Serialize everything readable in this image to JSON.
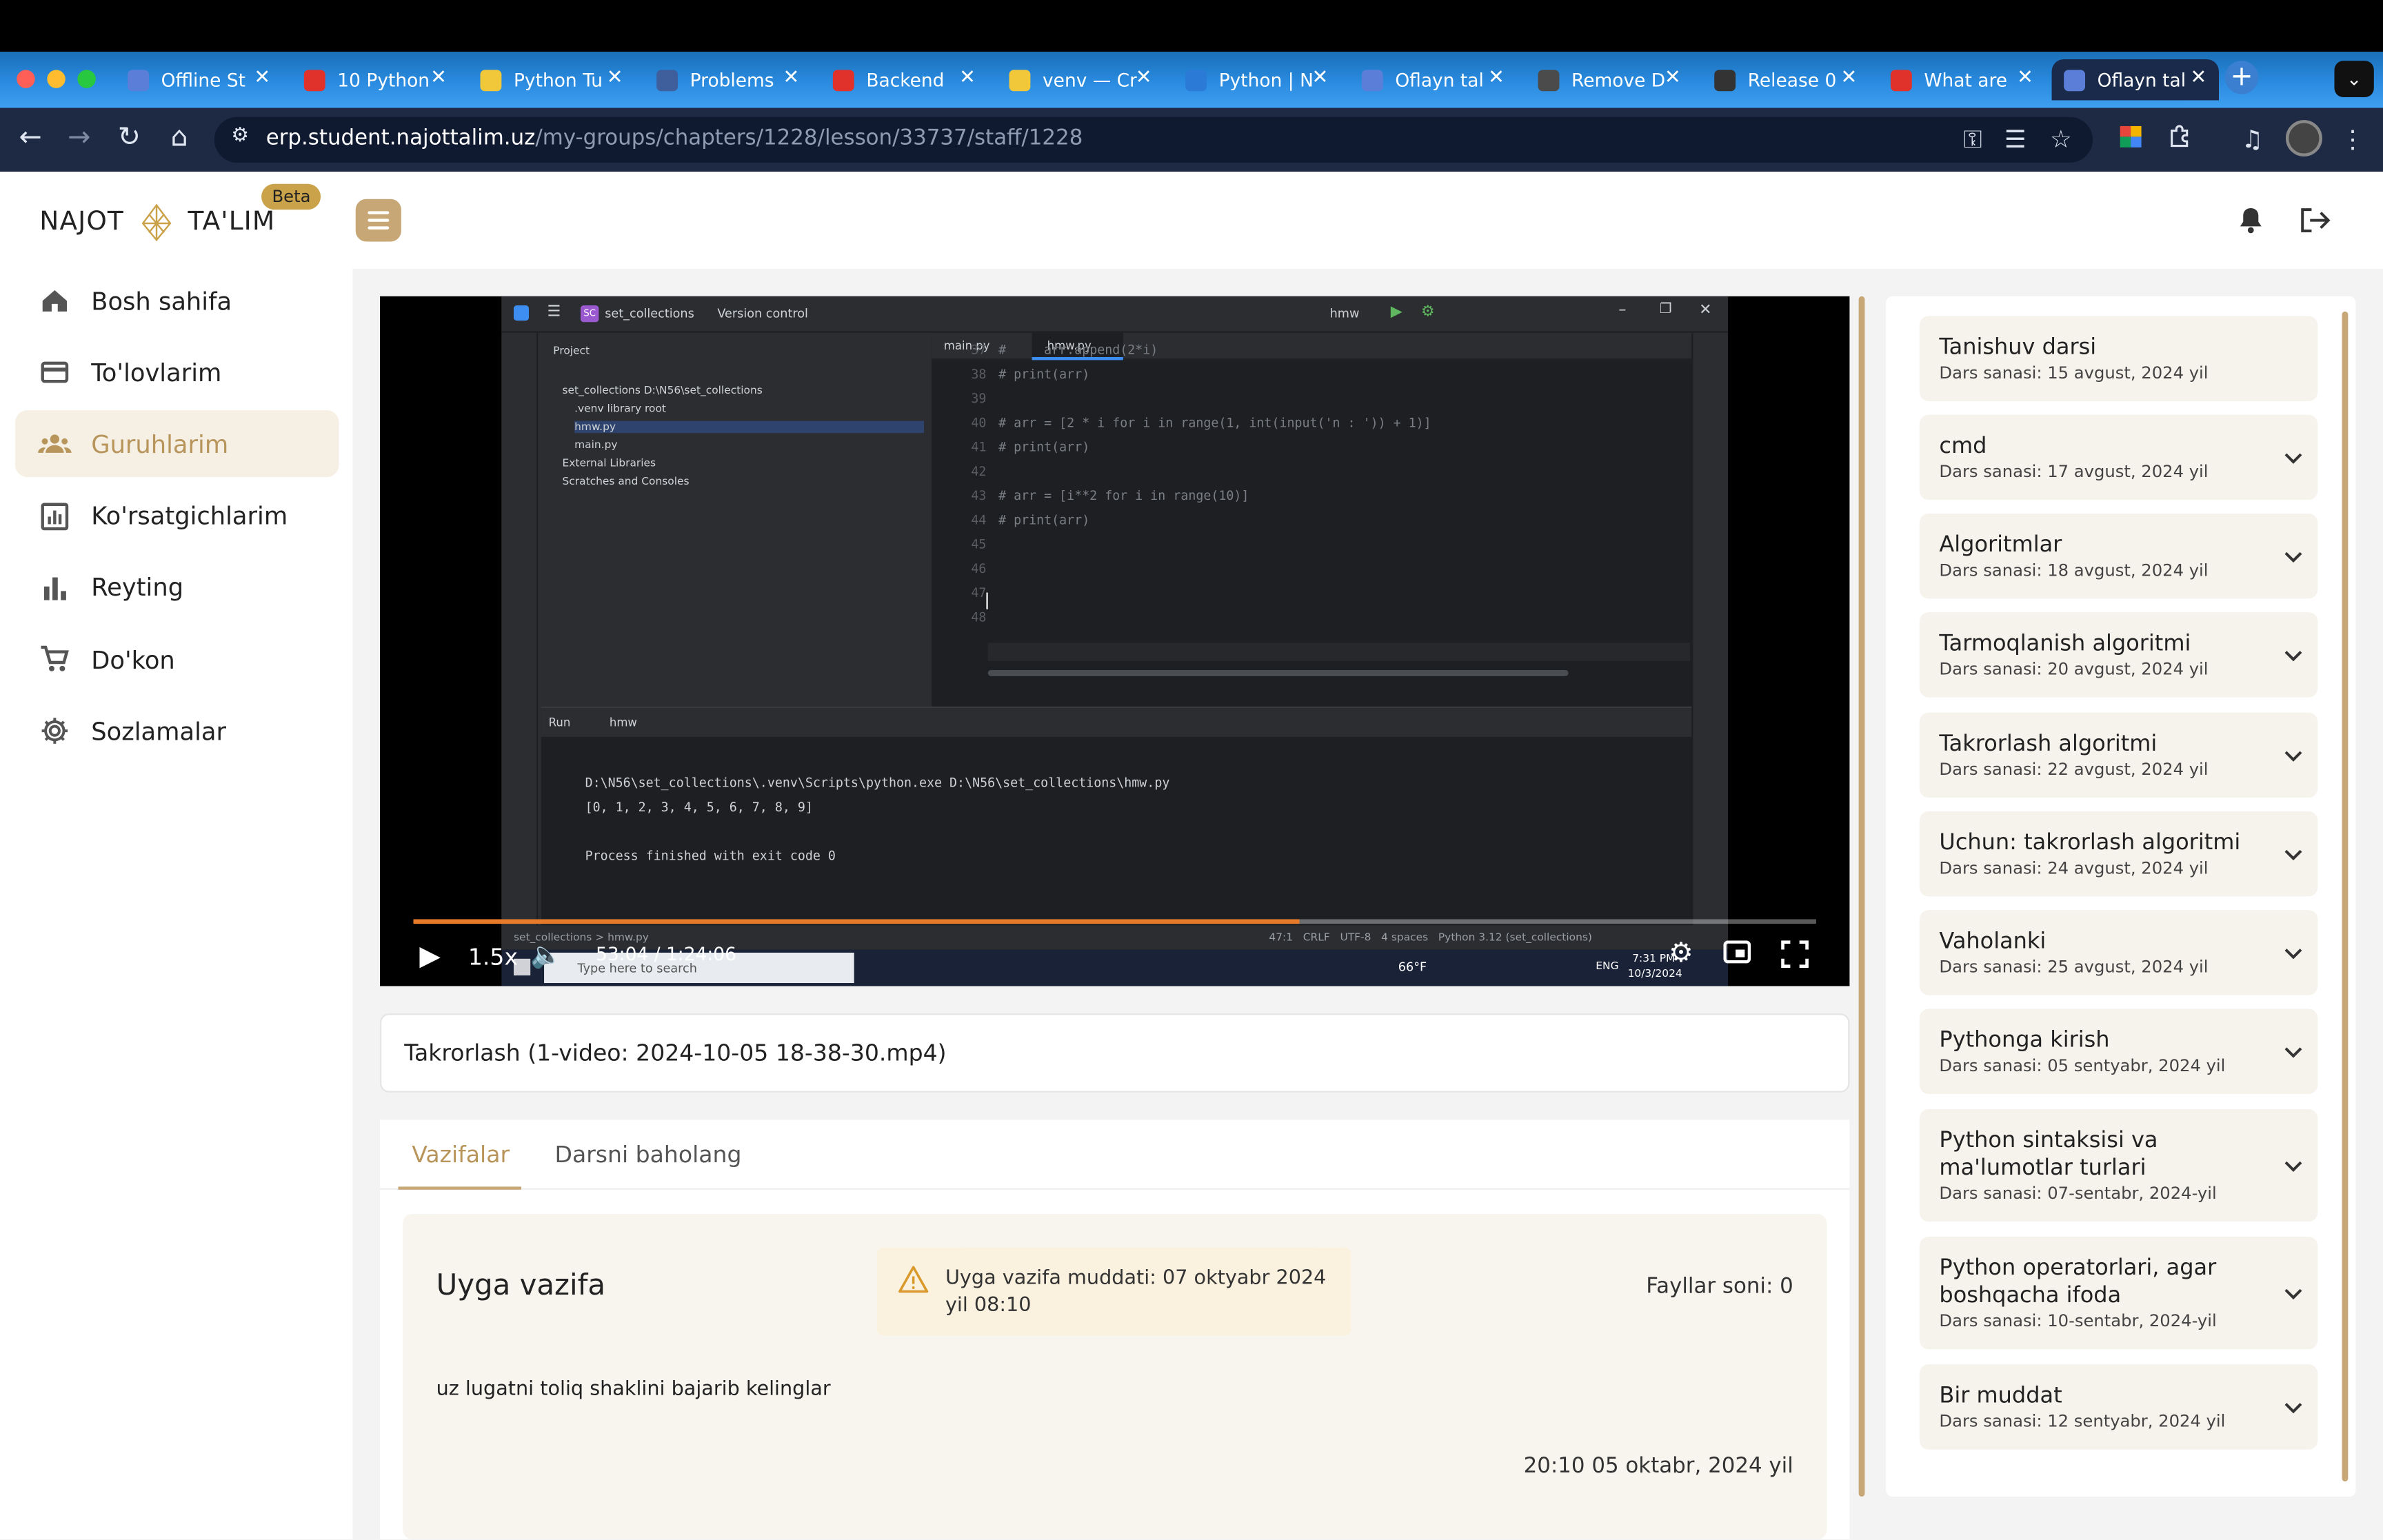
{
  "browser": {
    "tabs": [
      {
        "title": "Offline St",
        "color": "#5b7fd8"
      },
      {
        "title": "10 Python",
        "color": "#e0312b"
      },
      {
        "title": "Python Tu",
        "color": "#f2c83b"
      },
      {
        "title": "Problems",
        "color": "#3e5e9c"
      },
      {
        "title": "Backend",
        "color": "#e0312b"
      },
      {
        "title": "venv — Cr",
        "color": "#f2c83b"
      },
      {
        "title": "Python | N",
        "color": "#2a7ad6"
      },
      {
        "title": "Oflayn tal",
        "color": "#5b7fd8"
      },
      {
        "title": "Remove D",
        "color": "#4b4b4b"
      },
      {
        "title": "Release 0",
        "color": "#333333"
      },
      {
        "title": "What are",
        "color": "#e0312b"
      },
      {
        "title": "Oflayn tal",
        "color": "#5b7fd8"
      }
    ],
    "url_host": "erp.student.najottalim.uz",
    "url_path": "/my-groups/chapters/1228/lesson/33737/staff/1228"
  },
  "sidebar": {
    "logo_left": "NAJOT",
    "logo_right": "TA'LIM",
    "beta": "Beta",
    "items": [
      {
        "label": "Bosh sahifa",
        "icon": "home-icon"
      },
      {
        "label": "To'lovlarim",
        "icon": "card-icon"
      },
      {
        "label": "Guruhlarim",
        "icon": "group-icon"
      },
      {
        "label": "Ko'rsatgichlarim",
        "icon": "chart-icon"
      },
      {
        "label": "Reyting",
        "icon": "bar-icon"
      },
      {
        "label": "Do'kon",
        "icon": "cart-icon"
      },
      {
        "label": "Sozlamalar",
        "icon": "gear-icon"
      }
    ],
    "active_index": 2
  },
  "video": {
    "speed": "1.5x",
    "time": "53:04 / 1:24:06",
    "progress": 0.632,
    "ide": {
      "project_name": "set_collections",
      "vcs": "Version control",
      "run_config": "hmw",
      "tab1": "main.py",
      "tab2": "hmw.py",
      "tree": [
        "Project",
        "set_collections  D:\\N56\\set_collections",
        ".venv  library root",
        "hmw.py",
        "main.py",
        "External Libraries",
        "Scratches and Consoles"
      ],
      "code": [
        {
          "n": "37",
          "t": "#     arr.append(2*i)"
        },
        {
          "n": "38",
          "t": "# print(arr)"
        },
        {
          "n": "39",
          "t": ""
        },
        {
          "n": "40",
          "t": "# arr = [2 * i for i in range(1, int(input('n : ')) + 1)]"
        },
        {
          "n": "41",
          "t": "# print(arr)"
        },
        {
          "n": "42",
          "t": ""
        },
        {
          "n": "43",
          "t": "# arr = [i**2 for i in range(10)]"
        },
        {
          "n": "44",
          "t": "# print(arr)"
        },
        {
          "n": "45",
          "t": ""
        },
        {
          "n": "46",
          "t": ""
        },
        {
          "n": "47",
          "t": ""
        },
        {
          "n": "48",
          "t": ""
        }
      ],
      "run_label": "Run",
      "run_tab": "hmw",
      "output": [
        "D:\\N56\\set_collections\\.venv\\Scripts\\python.exe D:\\N56\\set_collections\\hmw.py",
        "[0, 1, 2, 3, 4, 5, 6, 7, 8, 9]",
        "",
        "Process finished with exit code 0"
      ],
      "status_path": "set_collections > hmw.py",
      "status_right": "47:1   CRLF   UTF-8   4 spaces   Python 3.12 (set_collections)",
      "search_placeholder": "Type here to search",
      "weather": "66°F",
      "lang": "ENG",
      "clock": "7:31 PM",
      "clock_date": "10/3/2024"
    }
  },
  "lesson_title": "Takrorlash (1-video: 2024-10-05 18-38-30.mp4)",
  "tabs": [
    "Vazifalar",
    "Darsni baholang"
  ],
  "homework": {
    "title": "Uyga vazifa",
    "deadline": "Uyga vazifa muddati: 07 oktyabr 2024 yil 08:10",
    "files": "Fayllar soni: 0",
    "description": "uz lugatni toliq shaklini bajarib kelinglar",
    "date": "20:10 05 oktabr, 2024 yil"
  },
  "lessons": [
    {
      "name": "Tanishuv darsi",
      "date": "Dars sanasi: 15 avgust, 2024 yil",
      "chevron": false
    },
    {
      "name": "cmd",
      "date": "Dars sanasi: 17 avgust, 2024 yil",
      "chevron": true
    },
    {
      "name": "Algoritmlar",
      "date": "Dars sanasi: 18 avgust, 2024 yil",
      "chevron": true
    },
    {
      "name": "Tarmoqlanish algoritmi",
      "date": "Dars sanasi: 20 avgust, 2024 yil",
      "chevron": true
    },
    {
      "name": "Takrorlash algoritmi",
      "date": "Dars sanasi: 22 avgust, 2024 yil",
      "chevron": true
    },
    {
      "name": "Uchun: takrorlash algoritmi",
      "date": "Dars sanasi: 24 avgust, 2024 yil",
      "chevron": true
    },
    {
      "name": "Vaholanki",
      "date": "Dars sanasi: 25 avgust, 2024 yil",
      "chevron": true
    },
    {
      "name": "Pythonga kirish",
      "date": "Dars sanasi: 05 sentyabr, 2024 yil",
      "chevron": true
    },
    {
      "name": "Python sintaksisi va ma'lumotlar turlari",
      "date": "Dars sanasi: 07-sentabr, 2024-yil",
      "chevron": true
    },
    {
      "name": "Python operatorlari, agar boshqacha ifoda",
      "date": "Dars sanasi: 10-sentabr, 2024-yil",
      "chevron": true
    },
    {
      "name": "Bir muddat",
      "date": "Dars sanasi: 12 sentyabr, 2024 yil",
      "chevron": true
    }
  ]
}
